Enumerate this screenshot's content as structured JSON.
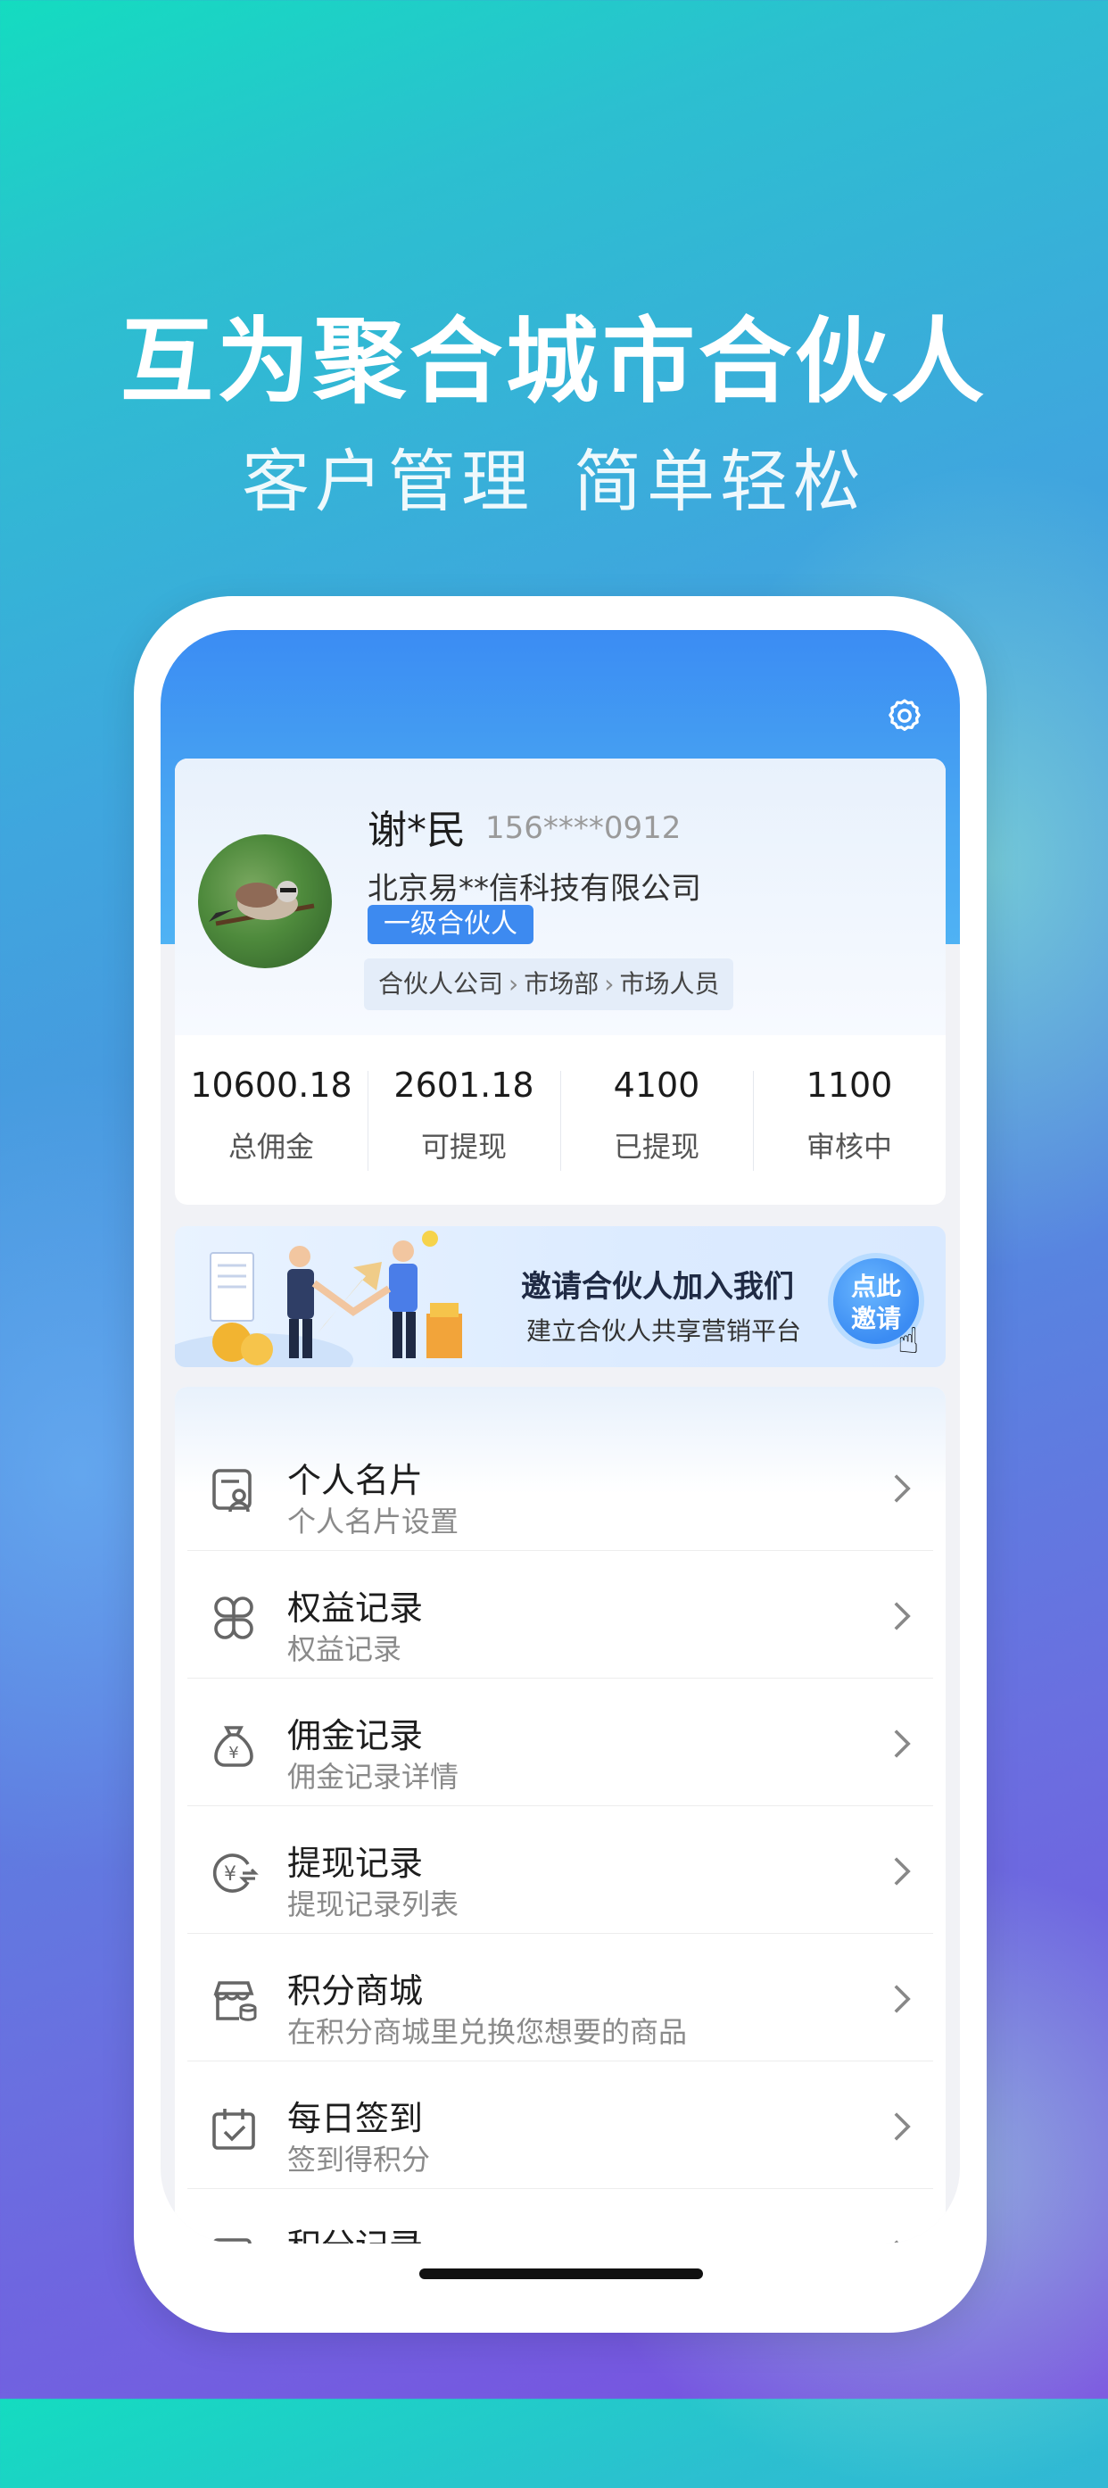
{
  "promo": {
    "headline": "互为聚合城市合伙人",
    "sub1": "客户管理",
    "sub2": "简单轻松"
  },
  "profile": {
    "name": "谢*民",
    "phone": "156****0912",
    "company": "北京易**信科技有限公司",
    "level": "一级合伙人",
    "breadcrumb": [
      "合伙人公司",
      "市场部",
      "市场人员"
    ]
  },
  "stats": [
    {
      "value": "10600.18",
      "label": "总佣金"
    },
    {
      "value": "2601.18",
      "label": "可提现"
    },
    {
      "value": "4100",
      "label": "已提现"
    },
    {
      "value": "1100",
      "label": "审核中"
    }
  ],
  "banner": {
    "title": "邀请合伙人加入我们",
    "subtitle": "建立合伙人共享营销平台",
    "button_line1": "点此",
    "button_line2": "邀请"
  },
  "menu": [
    {
      "title": "个人名片",
      "subtitle": "个人名片设置",
      "icon": "id-card-icon"
    },
    {
      "title": "权益记录",
      "subtitle": "权益记录",
      "icon": "clover-icon"
    },
    {
      "title": "佣金记录",
      "subtitle": "佣金记录详情",
      "icon": "money-bag-icon"
    },
    {
      "title": "提现记录",
      "subtitle": "提现记录列表",
      "icon": "yen-transfer-icon"
    },
    {
      "title": "积分商城",
      "subtitle": "在积分商城里兑换您想要的商品",
      "icon": "store-icon"
    },
    {
      "title": "每日签到",
      "subtitle": "签到得积分",
      "icon": "calendar-check-icon"
    },
    {
      "title": "积分记录",
      "subtitle": "",
      "icon": "points-record-icon"
    }
  ],
  "colors": {
    "accent": "#3d8af0",
    "header_blue": "#49a7f2"
  }
}
